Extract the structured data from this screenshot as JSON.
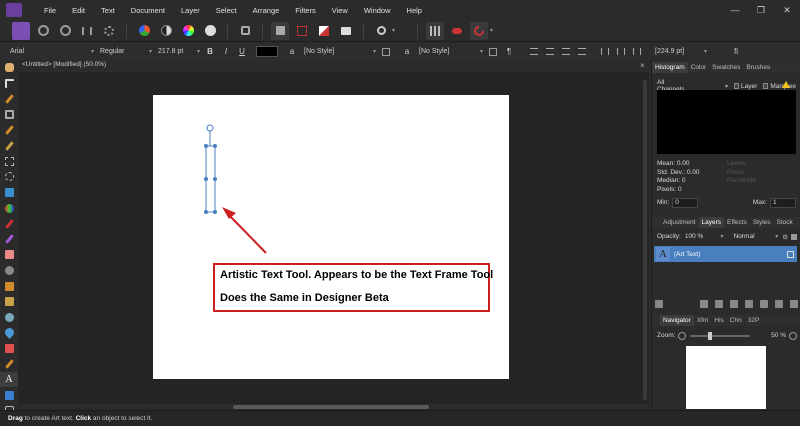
{
  "menubar": {
    "items": [
      "File",
      "Edit",
      "Text",
      "Document",
      "Layer",
      "Select",
      "Arrange",
      "Filters",
      "View",
      "Window",
      "Help"
    ],
    "window_controls": [
      "—",
      "❐",
      "✕"
    ]
  },
  "context_toolbar": {
    "font_family": "Arial",
    "font_style": "Regular",
    "font_size": "217.8 pt",
    "bold": "B",
    "italic": "I",
    "underline": "U",
    "fill_color": "#000000",
    "char_style_glyph": "a",
    "char_style": "[No Style]",
    "para_style_glyph": "a",
    "para_style": "[No Style]",
    "para_mark": "¶",
    "leading_value": "[224.9 pt]",
    "fi_label": "fi"
  },
  "document": {
    "tab_title": "<Untitled> [Modified] (50.0%)",
    "close_glyph": "×"
  },
  "annotation": {
    "line1": "Artistic Text Tool. Appears to be the Text Frame Tool",
    "line2": "Does the Same in Designer Beta",
    "border_color": "#cc1f1f"
  },
  "panels": {
    "top_tabs": [
      "Histogram",
      "Color",
      "Swatches",
      "Brushes"
    ],
    "histogram": {
      "channel": "All Channels",
      "layer_label": "Layer",
      "marquee_label": "Marquee",
      "stats": [
        "Mean: 0.00",
        "Std. Dev.: 0.00",
        "Median: 0",
        "Pixels: 0"
      ],
      "stats_dim": [
        "Levels",
        "Pixels",
        "Percentile"
      ],
      "min_label": "Min:",
      "min_value": "0",
      "max_label": "Max:",
      "max_value": "1"
    },
    "mid_tabs": [
      "Adjustment",
      "Layers",
      "Effects",
      "Styles",
      "Stock"
    ],
    "layers": {
      "opacity_label": "Opacity:",
      "opacity_value": "100 %",
      "blend_mode": "Normal",
      "items": [
        {
          "thumb": "A",
          "name": "(Art Text)"
        }
      ]
    },
    "bottom_tabs": [
      "Navigator",
      "Xfm",
      "His",
      "Chn",
      "32P"
    ],
    "navigator": {
      "zoom_label": "Zoom:",
      "zoom_value": "50 %"
    }
  },
  "status": {
    "drag_word": "Drag",
    "drag_rest": " to create Art text. ",
    "click_word": "Click",
    "click_rest": " an object to select it."
  }
}
